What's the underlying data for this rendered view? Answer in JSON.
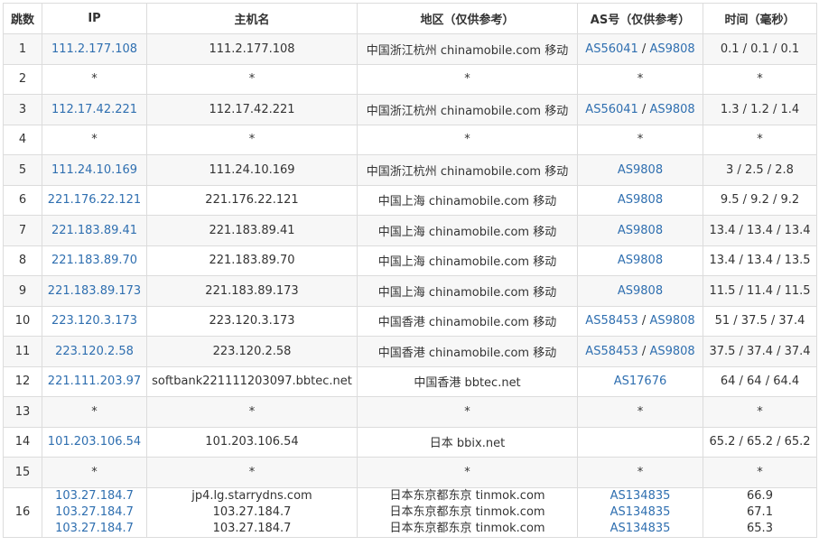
{
  "headers": [
    "跳数",
    "IP",
    "主机名",
    "地区（仅供参考）",
    "AS号（仅供参考）",
    "时间（毫秒）"
  ],
  "rows": [
    {
      "hop": "1",
      "ip": [
        "111.2.177.108"
      ],
      "host": [
        "111.2.177.108"
      ],
      "region": [
        "中国浙江杭州 chinamobile.com 移动"
      ],
      "asn": [
        [
          "AS56041",
          "AS9808"
        ]
      ],
      "time": [
        "0.1 / 0.1 / 0.1"
      ]
    },
    {
      "hop": "2",
      "ip": [
        "*"
      ],
      "host": [
        "*"
      ],
      "region": [
        "*"
      ],
      "asn": [
        [
          "*"
        ]
      ],
      "time": [
        "*"
      ],
      "star": true
    },
    {
      "hop": "3",
      "ip": [
        "112.17.42.221"
      ],
      "host": [
        "112.17.42.221"
      ],
      "region": [
        "中国浙江杭州 chinamobile.com 移动"
      ],
      "asn": [
        [
          "AS56041",
          "AS9808"
        ]
      ],
      "time": [
        "1.3 / 1.2 / 1.4"
      ]
    },
    {
      "hop": "4",
      "ip": [
        "*"
      ],
      "host": [
        "*"
      ],
      "region": [
        "*"
      ],
      "asn": [
        [
          "*"
        ]
      ],
      "time": [
        "*"
      ],
      "star": true
    },
    {
      "hop": "5",
      "ip": [
        "111.24.10.169"
      ],
      "host": [
        "111.24.10.169"
      ],
      "region": [
        "中国浙江杭州 chinamobile.com 移动"
      ],
      "asn": [
        [
          "AS9808"
        ]
      ],
      "time": [
        "3 / 2.5 / 2.8"
      ]
    },
    {
      "hop": "6",
      "ip": [
        "221.176.22.121"
      ],
      "host": [
        "221.176.22.121"
      ],
      "region": [
        "中国上海 chinamobile.com 移动"
      ],
      "asn": [
        [
          "AS9808"
        ]
      ],
      "time": [
        "9.5 / 9.2 / 9.2"
      ]
    },
    {
      "hop": "7",
      "ip": [
        "221.183.89.41"
      ],
      "host": [
        "221.183.89.41"
      ],
      "region": [
        "中国上海 chinamobile.com 移动"
      ],
      "asn": [
        [
          "AS9808"
        ]
      ],
      "time": [
        "13.4 / 13.4 / 13.4"
      ]
    },
    {
      "hop": "8",
      "ip": [
        "221.183.89.70"
      ],
      "host": [
        "221.183.89.70"
      ],
      "region": [
        "中国上海 chinamobile.com 移动"
      ],
      "asn": [
        [
          "AS9808"
        ]
      ],
      "time": [
        "13.4 / 13.4 / 13.5"
      ]
    },
    {
      "hop": "9",
      "ip": [
        "221.183.89.173"
      ],
      "host": [
        "221.183.89.173"
      ],
      "region": [
        "中国上海 chinamobile.com 移动"
      ],
      "asn": [
        [
          "AS9808"
        ]
      ],
      "time": [
        "11.5 / 11.4 / 11.5"
      ]
    },
    {
      "hop": "10",
      "ip": [
        "223.120.3.173"
      ],
      "host": [
        "223.120.3.173"
      ],
      "region": [
        "中国香港 chinamobile.com 移动"
      ],
      "asn": [
        [
          "AS58453",
          "AS9808"
        ]
      ],
      "time": [
        "51 / 37.5 / 37.4"
      ]
    },
    {
      "hop": "11",
      "ip": [
        "223.120.2.58"
      ],
      "host": [
        "223.120.2.58"
      ],
      "region": [
        "中国香港 chinamobile.com 移动"
      ],
      "asn": [
        [
          "AS58453",
          "AS9808"
        ]
      ],
      "time": [
        "37.5 / 37.4 / 37.4"
      ]
    },
    {
      "hop": "12",
      "ip": [
        "221.111.203.97"
      ],
      "host": [
        "softbank221111203097.bbtec.net"
      ],
      "region": [
        "中国香港 bbtec.net"
      ],
      "asn": [
        [
          "AS17676"
        ]
      ],
      "time": [
        "64 / 64 / 64.4"
      ]
    },
    {
      "hop": "13",
      "ip": [
        "*"
      ],
      "host": [
        "*"
      ],
      "region": [
        "*"
      ],
      "asn": [
        [
          "*"
        ]
      ],
      "time": [
        "*"
      ],
      "star": true
    },
    {
      "hop": "14",
      "ip": [
        "101.203.106.54"
      ],
      "host": [
        "101.203.106.54"
      ],
      "region": [
        "日本 bbix.net"
      ],
      "asn": [
        []
      ],
      "time": [
        "65.2 / 65.2 / 65.2"
      ]
    },
    {
      "hop": "15",
      "ip": [
        "*"
      ],
      "host": [
        "*"
      ],
      "region": [
        "*"
      ],
      "asn": [
        [
          "*"
        ]
      ],
      "time": [
        "*"
      ],
      "star": true
    },
    {
      "hop": "16",
      "ip": [
        "103.27.184.7",
        "103.27.184.7",
        "103.27.184.7"
      ],
      "host": [
        "jp4.lg.starrydns.com",
        "103.27.184.7",
        "103.27.184.7"
      ],
      "region": [
        "日本东京都东京 tinmok.com",
        "日本东京都东京 tinmok.com",
        "日本东京都东京 tinmok.com"
      ],
      "asn": [
        [
          "AS134835"
        ],
        [
          "AS134835"
        ],
        [
          "AS134835"
        ]
      ],
      "time": [
        "66.9",
        "67.1",
        "65.3"
      ]
    }
  ],
  "colors": {
    "link": "#2f6fb0",
    "border": "#dcdcdc",
    "stripe": "#f7f7f7",
    "text": "#333333"
  }
}
